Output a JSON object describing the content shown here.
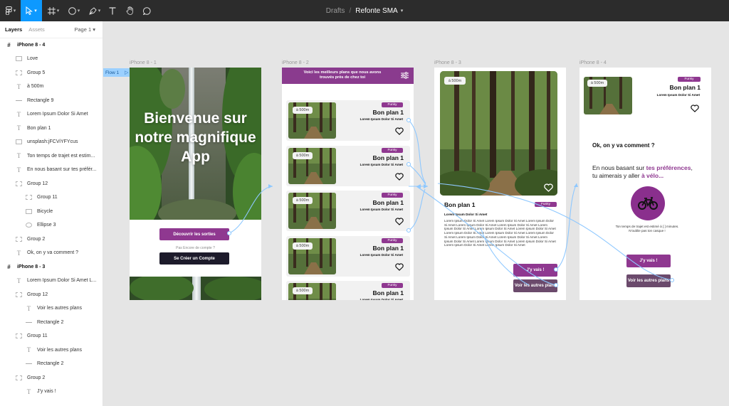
{
  "app": {
    "breadcrumb": "Drafts",
    "file_name": "Refonte SMA",
    "accent": "#0d99ff",
    "brand_purple": "#8f3890"
  },
  "toolbar": {
    "icons": [
      "figma-menu-icon",
      "move-icon",
      "frame-icon",
      "ellipse-icon",
      "pen-icon",
      "text-icon",
      "hand-icon",
      "comment-icon"
    ]
  },
  "panel": {
    "tab_layers": "Layers",
    "tab_assets": "Assets",
    "page": "Page 1"
  },
  "layers": [
    {
      "label": "iPhone 8 - 4",
      "type": "frame"
    },
    {
      "label": "Love",
      "type": "image"
    },
    {
      "label": "Group 5",
      "type": "group"
    },
    {
      "label": "à 500m",
      "type": "text"
    },
    {
      "label": "Rectangle 9",
      "type": "rect"
    },
    {
      "label": "Lorem Ipsum Dolor Si Amet",
      "type": "text"
    },
    {
      "label": "Bon plan 1",
      "type": "text"
    },
    {
      "label": "unsplash:jFCViYFYcus",
      "type": "image"
    },
    {
      "label": "Ton temps de trajet est estim...",
      "type": "text"
    },
    {
      "label": "En nous basant sur tes préfér...",
      "type": "text"
    },
    {
      "label": "Group 12",
      "type": "group"
    },
    {
      "label": "Group 11",
      "type": "group"
    },
    {
      "label": "Bicycle",
      "type": "image"
    },
    {
      "label": "Ellipse 3",
      "type": "ellipse"
    },
    {
      "label": "Group 2",
      "type": "group"
    },
    {
      "label": "Ok, on y va comment ?",
      "type": "text"
    },
    {
      "label": "iPhone 8 - 3",
      "type": "frame"
    },
    {
      "label": "Lorem Ipsum Dolor Si Amet L...",
      "type": "text"
    },
    {
      "label": "Group 12",
      "type": "group"
    },
    {
      "label": "Voir les autres plans",
      "type": "text"
    },
    {
      "label": "Rectangle 2",
      "type": "rect"
    },
    {
      "label": "Group 11",
      "type": "group"
    },
    {
      "label": "Voir les autres plans",
      "type": "text"
    },
    {
      "label": "Rectangle 2",
      "type": "rect"
    },
    {
      "label": "Group 2",
      "type": "group"
    },
    {
      "label": "J'y vais !",
      "type": "text"
    }
  ],
  "canvas": {
    "flow_label": "Flow 1",
    "frame_labels": [
      "iPhone 8 - 1",
      "iPhone 8 - 2",
      "iPhone 8 - 3",
      "iPhone 8 - 4"
    ]
  },
  "frame1": {
    "title": "Bienvenue sur notre magnifique App",
    "discover_button": "Découvrir les sorties",
    "no_account": "Pas Encore de compte ?",
    "create_button": "Se Créer un Compte"
  },
  "frame2": {
    "header": "Voici les meilleurs plans que nous avons trouvés près de chez toi",
    "cards": [
      {
        "distance": "à 500m",
        "badge": "Funky",
        "title": "Bon plan 1",
        "subtitle": "Lorem Ipsum Dolor Si Amet"
      },
      {
        "distance": "à 500m",
        "badge": "Funky",
        "title": "Bon plan 1",
        "subtitle": "Lorem Ipsum Dolor Si Amet"
      },
      {
        "distance": "à 500m",
        "badge": "Funky",
        "title": "Bon plan 1",
        "subtitle": "Lorem Ipsum Dolor Si Amet"
      },
      {
        "distance": "à 500m",
        "badge": "Funky",
        "title": "Bon plan 1",
        "subtitle": "Lorem Ipsum Dolor Si Amet"
      },
      {
        "distance": "à 500m",
        "badge": "Funky",
        "title": "Bon plan 1",
        "subtitle": "Lorem Ipsum Dolor Si Amet"
      }
    ]
  },
  "frame3": {
    "distance": "à 500m",
    "title": "Bon plan 1",
    "badge": "Funky",
    "subtitle": "Lorem Ipsum Dolor Si Amet",
    "paragraph": "Lorem Ipsum Dolor Si Amet Lorem Ipsum Dolor Si Amet Lorem Ipsum Dolor Si Amet Lorem Ipsum Dolor Si Amet Lorem Ipsum Dolor Si Amet Lorem Ipsum Dolor Si Amet Lorem Ipsum Dolor Si Amet Lorem Ipsum Dolor Si Amet Lorem Ipsum Dolor Si Amet Lorem Ipsum Dolor Si Amet Lorem Ipsum Dolor Si Amet Lorem Ipsum Dolor Si Amet Lorem Ipsum Dolor Si Amet Lorem Ipsum Dolor Si Amet Lorem Ipsum Dolor Si Amet Lorem Ipsum Dolor Si Amet Lorem Ipsum Dolor Si Amet Lorem Ipsum Dolor Si Amet",
    "go_button": "J'y vais !",
    "others_button": "Voir les autres plans"
  },
  "frame4": {
    "distance": "à 500m",
    "badge": "Funky",
    "title": "Bon plan 1",
    "subtitle": "Lorem Ipsum Dolor Si Amet",
    "question": "Ok, on y va comment ?",
    "pref_1": "En nous basant sur ",
    "pref_2": "tes préférences",
    "pref_3": ",",
    "pref_4": "tu aimerais y aller ",
    "pref_5": "à vélo...",
    "time_line1": "Ton temps de trajet est estimé à [ ] minutes.",
    "time_line2": "N'oublie pas ton casque !",
    "go_button": "J'y vais !",
    "others_button": "Voir les autres plans"
  }
}
